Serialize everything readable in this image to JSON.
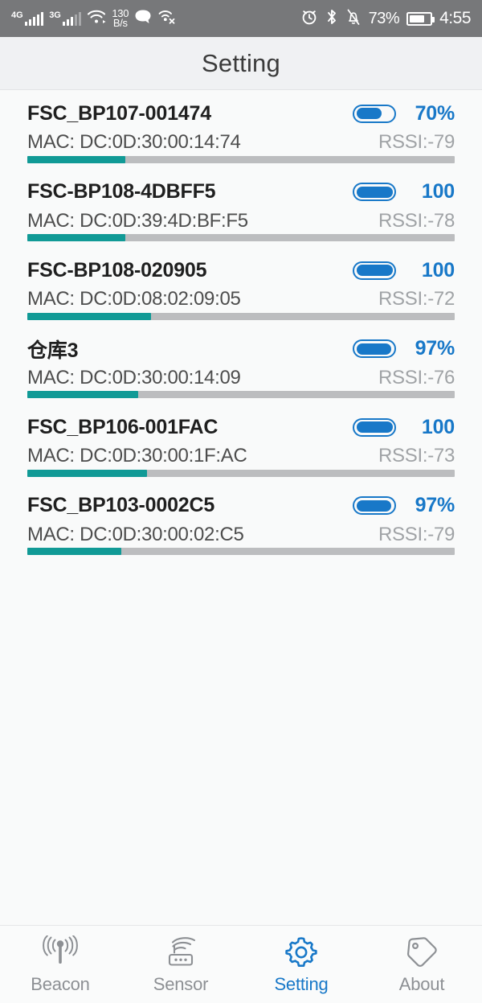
{
  "statusbar": {
    "signal1_gen": "4G",
    "signal2_gen": "3G",
    "wifi_icon": "wifi-icon",
    "data_rate_value": "130",
    "data_rate_unit": "B/s",
    "message_icon": "chat-bubble-icon",
    "location_off_icon": "location-off-icon",
    "alarm_icon": "alarm-clock-icon",
    "bluetooth_icon": "bluetooth-icon",
    "mute_icon": "bell-muted-icon",
    "battery_percent": "73%",
    "battery_icon": "battery-icon",
    "time": "4:55"
  },
  "header": {
    "title": "Setting"
  },
  "list": {
    "mac_prefix": "MAC: ",
    "rssi_prefix": "RSSI:",
    "items": [
      {
        "name": "FSC_BP107-001474",
        "mac": "MAC: DC:0D:30:00:14:74",
        "battery": "70%",
        "battery_fill": 70,
        "rssi": "RSSI:-79",
        "progress": 23
      },
      {
        "name": "FSC-BP108-4DBFF5",
        "mac": "MAC: DC:0D:39:4D:BF:F5",
        "battery": "100",
        "battery_fill": 100,
        "rssi": "RSSI:-78",
        "progress": 23
      },
      {
        "name": "FSC-BP108-020905",
        "mac": "MAC: DC:0D:08:02:09:05",
        "battery": "100",
        "battery_fill": 100,
        "rssi": "RSSI:-72",
        "progress": 29
      },
      {
        "name": "仓库3",
        "mac": "MAC: DC:0D:30:00:14:09",
        "battery": "97%",
        "battery_fill": 97,
        "rssi": "RSSI:-76",
        "progress": 26
      },
      {
        "name": "FSC_BP106-001FAC",
        "mac": "MAC: DC:0D:30:00:1F:AC",
        "battery": "100",
        "battery_fill": 100,
        "rssi": "RSSI:-73",
        "progress": 28
      },
      {
        "name": "FSC_BP103-0002C5",
        "mac": "MAC: DC:0D:30:00:02:C5",
        "battery": "97%",
        "battery_fill": 97,
        "rssi": "RSSI:-79",
        "progress": 22
      }
    ]
  },
  "tabbar": {
    "active_color": "#1878c8",
    "inactive_color": "#8d9094",
    "tabs": [
      {
        "label": "Beacon",
        "icon": "beacon-antenna-icon",
        "active": false
      },
      {
        "label": "Sensor",
        "icon": "sensor-router-icon",
        "active": false
      },
      {
        "label": "Setting",
        "icon": "gear-icon",
        "active": true
      },
      {
        "label": "About",
        "icon": "tag-icon",
        "active": false
      }
    ]
  }
}
